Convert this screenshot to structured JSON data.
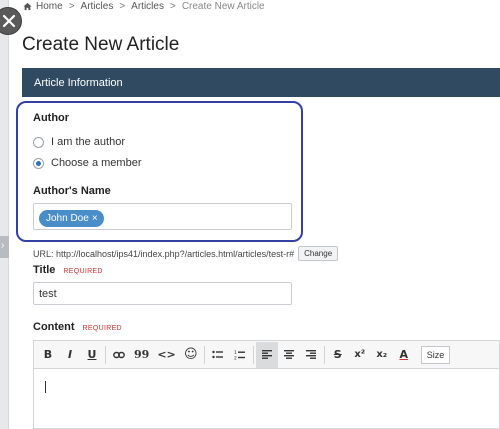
{
  "breadcrumb": {
    "items": [
      "Home",
      "Articles",
      "Articles"
    ],
    "current": "Create New Article",
    "separator": ">"
  },
  "page": {
    "title": "Create New Article"
  },
  "section": {
    "header": "Article Information"
  },
  "author": {
    "label": "Author",
    "options": [
      {
        "label": "I am the author",
        "checked": false
      },
      {
        "label": "Choose a member",
        "checked": true
      }
    ],
    "name_label": "Author's Name",
    "tags": [
      {
        "label": "John Doe",
        "remove": "×"
      }
    ]
  },
  "url": {
    "text": "URL: http://localhost/ips41/index.php?/articles.html/articles/test-r#",
    "change_label": "Change"
  },
  "title_field": {
    "label": "Title",
    "required": "REQUIRED",
    "value": "test"
  },
  "content_field": {
    "label": "Content",
    "required": "REQUIRED"
  },
  "toolbar": {
    "bold": "B",
    "italic": "I",
    "underline": "U",
    "link": "🔗",
    "quote": "99",
    "code": "<>",
    "emoji": "☺",
    "bullets": "☰",
    "numbers": "☰",
    "align_left": "≡",
    "align_center": "≡",
    "align_right": "≡",
    "strike": "S",
    "superscript": "x²",
    "subscript": "x₂",
    "font_color": "A",
    "size": "Size"
  },
  "colors": {
    "section_header": "#2f4a61",
    "highlight_border": "#3540a4",
    "tag_bg": "#4a8ec9",
    "required": "#d0312d"
  }
}
